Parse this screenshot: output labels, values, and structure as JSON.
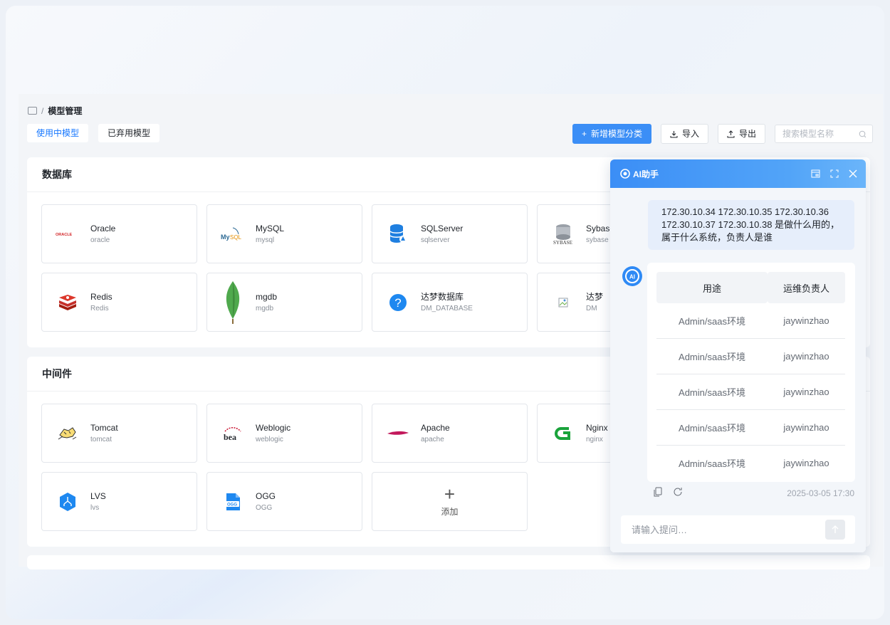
{
  "breadcrumb": {
    "separator": "/",
    "current": "模型管理"
  },
  "tabs": [
    {
      "label": "使用中模型",
      "active": true
    },
    {
      "label": "已弃用模型",
      "active": false
    }
  ],
  "toolbar": {
    "add_label": "新增模型分类",
    "import_label": "导入",
    "export_label": "导出",
    "search_placeholder": "搜索模型名称"
  },
  "sections": [
    {
      "title": "数据库",
      "cards": [
        {
          "name": "Oracle",
          "code": "oracle",
          "icon": "oracle-logo"
        },
        {
          "name": "MySQL",
          "code": "mysql",
          "icon": "mysql-logo"
        },
        {
          "name": "SQLServer",
          "code": "sqlserver",
          "icon": "sqlserver-logo"
        },
        {
          "name": "Sybase",
          "code": "sybase",
          "icon": "sybase-logo"
        },
        {
          "name": "Redis",
          "code": "Redis",
          "icon": "redis-logo"
        },
        {
          "name": "mgdb",
          "code": "mgdb",
          "icon": "mongodb-leaf-logo"
        },
        {
          "name": "达梦数据库",
          "code": "DM_DATABASE",
          "icon": "question-icon"
        },
        {
          "name": "达梦",
          "code": "DM",
          "icon": "broken-image-icon"
        }
      ]
    },
    {
      "title": "中间件",
      "cards": [
        {
          "name": "Tomcat",
          "code": "tomcat",
          "icon": "tomcat-logo"
        },
        {
          "name": "Weblogic",
          "code": "weblogic",
          "icon": "bea-logo"
        },
        {
          "name": "Apache",
          "code": "apache",
          "icon": "apache-feather-logo"
        },
        {
          "name": "Nginx",
          "code": "nginx",
          "icon": "nginx-logo"
        },
        {
          "name": "LVS",
          "code": "lvs",
          "icon": "lvs-logo"
        },
        {
          "name": "OGG",
          "code": "OGG",
          "icon": "ogg-logo"
        }
      ],
      "add_label": "添加"
    }
  ],
  "ai_panel": {
    "title": "AI助手",
    "question": "172.30.10.34 172.30.10.35 172.30.10.36 172.30.10.37 172.30.10.38 是做什么用的，属于什么系统，负责人是谁",
    "table": {
      "headers": [
        "用途",
        "运维负责人"
      ],
      "rows": [
        [
          "Admin/saas环境",
          "jaywinzhao"
        ],
        [
          "Admin/saas环境",
          "jaywinzhao"
        ],
        [
          "Admin/saas环境",
          "jaywinzhao"
        ],
        [
          "Admin/saas环境",
          "jaywinzhao"
        ],
        [
          "Admin/saas环境",
          "jaywinzhao"
        ]
      ]
    },
    "timestamp": "2025-03-05 17:30",
    "input_placeholder": "请输入提问…"
  },
  "colors": {
    "primary": "#3b8ef6",
    "page_bg": "#f3f5f8"
  }
}
